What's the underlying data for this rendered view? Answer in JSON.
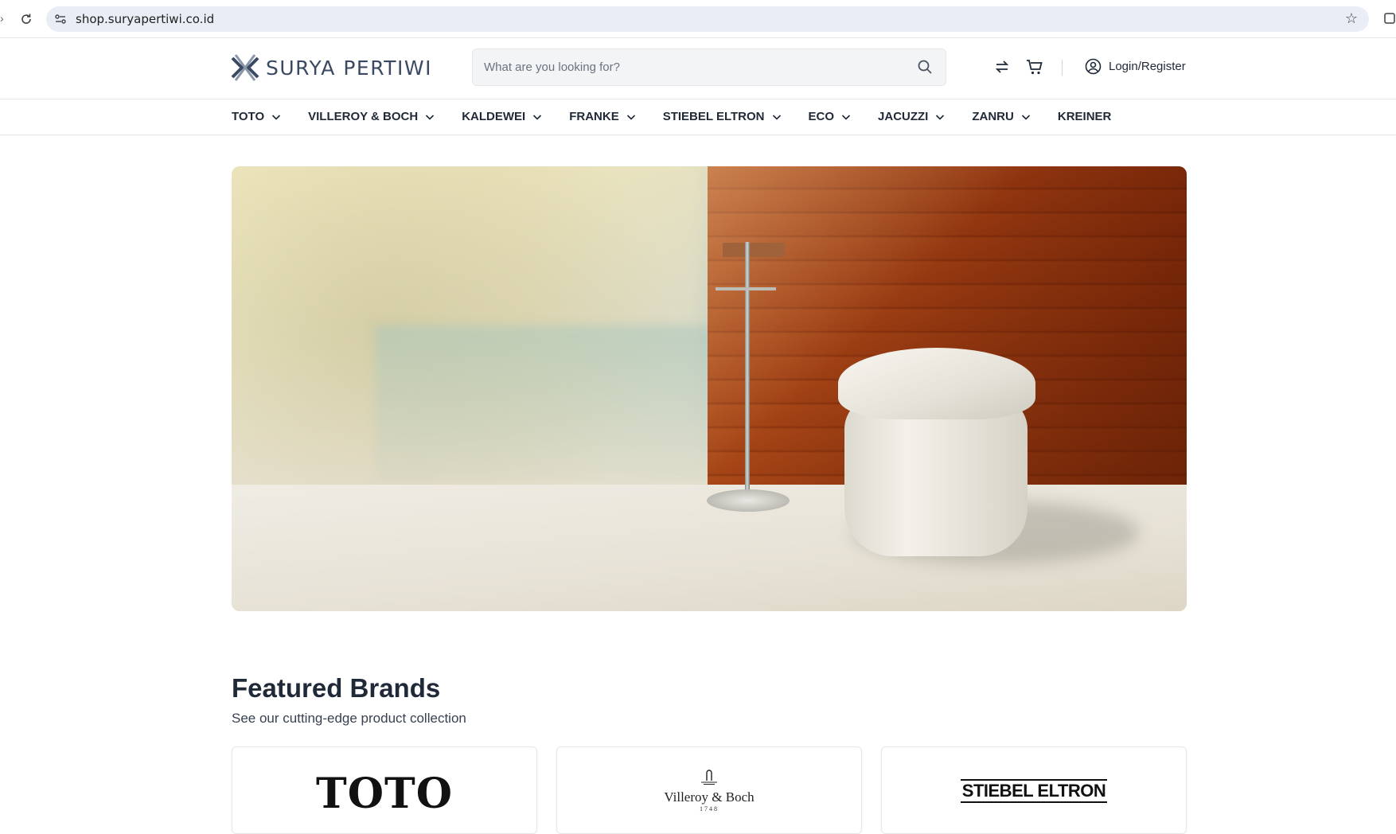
{
  "browser": {
    "url": "shop.suryapertiwi.co.id"
  },
  "header": {
    "brand_name": "SURYA PERTIWI",
    "search_placeholder": "What are you looking for?",
    "login_label": "Login/Register",
    "icons": [
      "search-icon",
      "compare-icon",
      "cart-icon",
      "user-icon"
    ]
  },
  "nav": {
    "items": [
      {
        "label": "TOTO",
        "dropdown": true
      },
      {
        "label": "VILLEROY & BOCH",
        "dropdown": true
      },
      {
        "label": "KALDEWEI",
        "dropdown": true
      },
      {
        "label": "FRANKE",
        "dropdown": true
      },
      {
        "label": "STIEBEL ELTRON",
        "dropdown": true
      },
      {
        "label": "ECO",
        "dropdown": true
      },
      {
        "label": "JACUZZI",
        "dropdown": true
      },
      {
        "label": "ZANRU",
        "dropdown": true
      },
      {
        "label": "KREINER",
        "dropdown": false
      }
    ]
  },
  "featured": {
    "title": "Featured Brands",
    "subtitle": "See our cutting-edge product collection",
    "brands": [
      {
        "name": "TOTO"
      },
      {
        "name": "Villeroy & Boch",
        "year": "1748"
      },
      {
        "name": "STIEBEL ELTRON"
      }
    ]
  },
  "colors": {
    "text": "#1f2937",
    "logo": "#3a4a63",
    "border": "#e5e7eb",
    "search_bg": "#f3f4f6"
  }
}
